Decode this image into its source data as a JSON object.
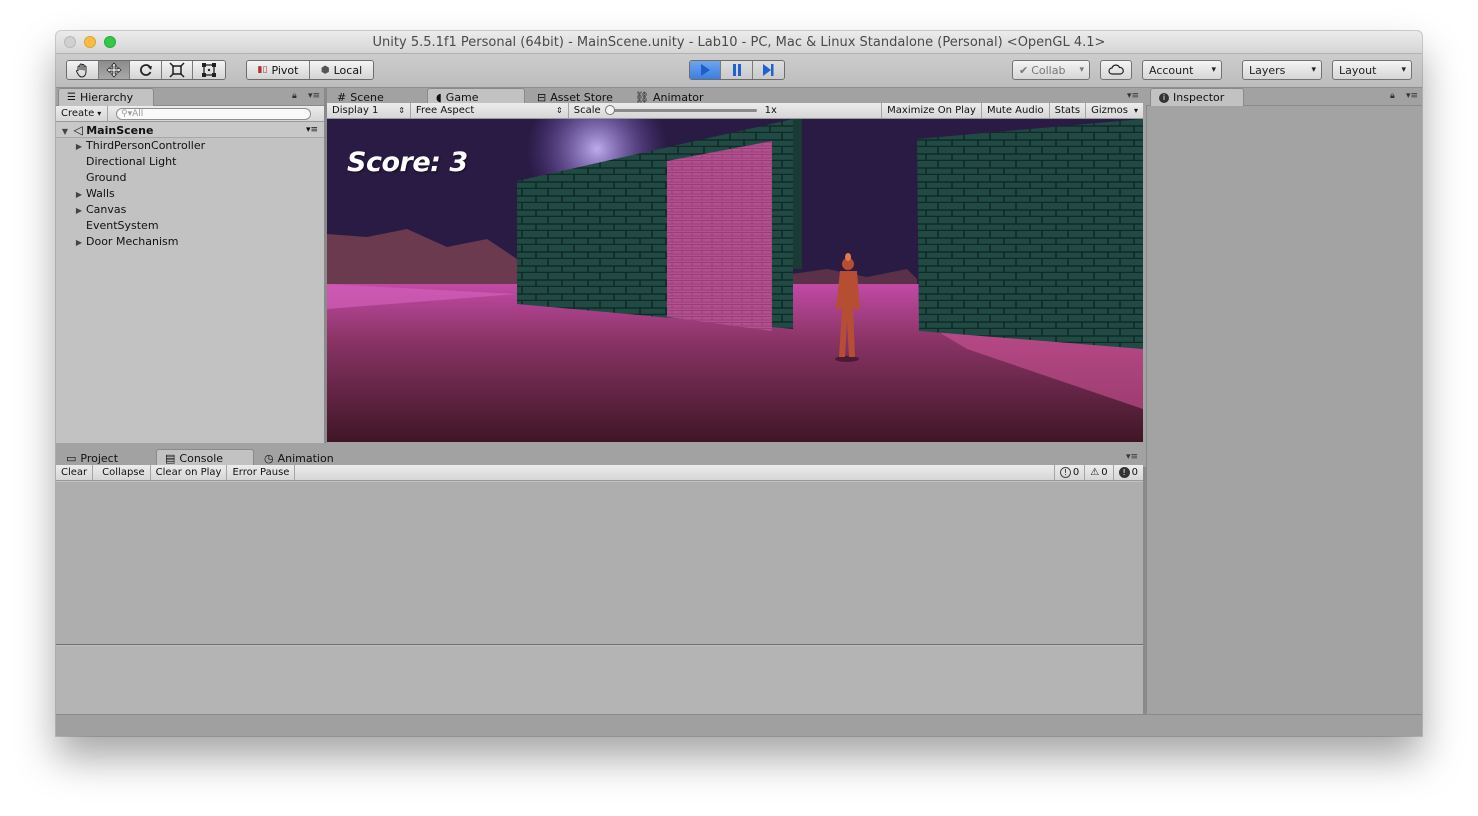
{
  "window": {
    "title": "Unity 5.5.1f1 Personal (64bit) - MainScene.unity - Lab10 - PC, Mac & Linux Standalone (Personal) <OpenGL 4.1>"
  },
  "toolbar": {
    "pivot_label": "Pivot",
    "local_label": "Local",
    "collab_label": "Collab",
    "account_label": "Account",
    "layers_label": "Layers",
    "layout_label": "Layout",
    "tools": [
      "hand-tool-icon",
      "move-tool-icon",
      "rotate-tool-icon",
      "scale-tool-icon",
      "rect-tool-icon"
    ],
    "play_color": "#3c7fe0"
  },
  "hierarchy": {
    "tab_label": "Hierarchy",
    "create_label": "Create",
    "search_placeholder": "All",
    "scene_name": "MainScene",
    "items": [
      {
        "label": "ThirdPersonController",
        "expandable": true
      },
      {
        "label": "Directional Light",
        "expandable": false
      },
      {
        "label": "Ground",
        "expandable": false
      },
      {
        "label": "Walls",
        "expandable": true
      },
      {
        "label": "Canvas",
        "expandable": true
      },
      {
        "label": "EventSystem",
        "expandable": false
      },
      {
        "label": "Door Mechanism",
        "expandable": true
      }
    ]
  },
  "center_tabs": {
    "scene": "Scene",
    "game": "Game",
    "asset_store": "Asset Store",
    "animator": "Animator"
  },
  "game_bar": {
    "display": "Display 1",
    "aspect": "Free Aspect",
    "scale_label": "Scale",
    "scale_value": "1x",
    "maximize": "Maximize On Play",
    "mute": "Mute Audio",
    "stats": "Stats",
    "gizmos": "Gizmos"
  },
  "game": {
    "score_text": "Score: 3"
  },
  "inspector": {
    "tab_label": "Inspector"
  },
  "bottom_tabs": {
    "project": "Project",
    "console": "Console",
    "animation": "Animation"
  },
  "console": {
    "clear": "Clear",
    "collapse": "Collapse",
    "clear_on_play": "Clear on Play",
    "error_pause": "Error Pause",
    "info_count": "0",
    "warning_count": "0",
    "error_count": "0"
  }
}
